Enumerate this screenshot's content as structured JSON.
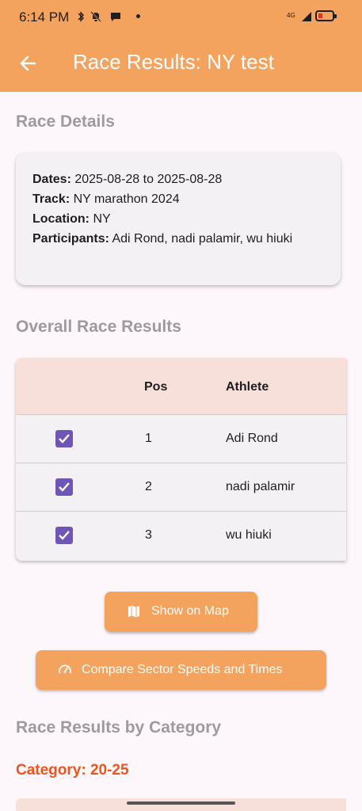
{
  "status_bar": {
    "time": "6:14 PM",
    "network": "4G"
  },
  "app_bar": {
    "title": "Race Results: NY test"
  },
  "race_details": {
    "heading": "Race Details",
    "dates_label": "Dates:",
    "dates_value": "2025-08-28 to 2025-08-28",
    "track_label": "Track:",
    "track_value": "NY marathon 2024",
    "location_label": "Location:",
    "location_value": "NY",
    "participants_label": "Participants:",
    "participants_value": "Adi Rond, nadi palamir, wu hiuki"
  },
  "overall_results": {
    "heading": "Overall Race Results",
    "columns": [
      "",
      "Pos",
      "Athlete"
    ],
    "rows": [
      {
        "checked": true,
        "pos": "1",
        "athlete": "Adi Rond"
      },
      {
        "checked": true,
        "pos": "2",
        "athlete": "nadi palamir"
      },
      {
        "checked": true,
        "pos": "3",
        "athlete": "wu hiuki"
      }
    ]
  },
  "buttons": {
    "show_on_map": "Show on Map",
    "compare": "Compare Sector Speeds and Times"
  },
  "by_category": {
    "heading": "Race Results by Category",
    "category_label": "Category: 20-25"
  },
  "colors": {
    "accent": "#f3a35d",
    "checkbox": "#6f55b5",
    "category": "#f0541e",
    "header_row": "#f7e0d9"
  }
}
